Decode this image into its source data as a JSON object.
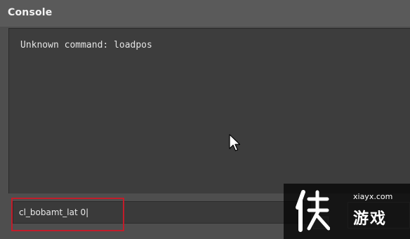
{
  "window": {
    "title": "Console"
  },
  "output": {
    "lines": [
      "Unknown command: loadpos"
    ]
  },
  "input": {
    "value": "cl_bobamt_lat 0|"
  },
  "watermark": {
    "url": "xiayx.com",
    "name": "游戏",
    "logo_icon": "xia-logo-icon"
  },
  "colors": {
    "highlight": "#c21d2a",
    "background": "#3d3d3d",
    "titlebar": "#5a5a5a"
  }
}
